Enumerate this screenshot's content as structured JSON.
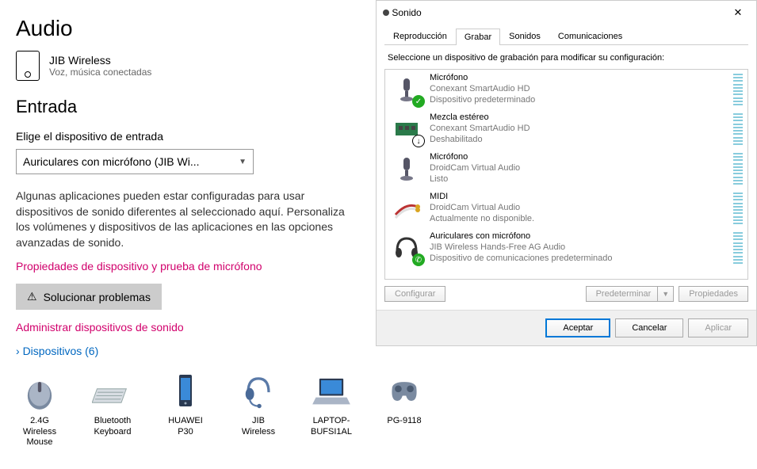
{
  "settings": {
    "title": "Audio",
    "device": {
      "name": "JIB Wireless",
      "status": "Voz, música conectadas"
    },
    "input_section": "Entrada",
    "input_label": "Elige el dispositivo de entrada",
    "input_value": "Auriculares con micrófono (JIB Wi...",
    "note": "Algunas aplicaciones pueden estar configuradas para usar dispositivos de sonido diferentes al seleccionado aquí. Personaliza los volúmenes y dispositivos de las aplicaciones en las opciones avanzadas de sonido.",
    "link_props": "Propiedades de dispositivo y prueba de micrófono",
    "troubleshoot": "Solucionar problemas",
    "link_manage": "Administrar dispositivos de sonido",
    "devices_header": "Dispositivos (6)",
    "devices": [
      {
        "label": "2.4G Wireless Mouse",
        "icon": "mouse"
      },
      {
        "label": "Bluetooth Keyboard",
        "icon": "keyboard"
      },
      {
        "label": "HUAWEI P30",
        "icon": "phone"
      },
      {
        "label": "JIB Wireless",
        "icon": "headset"
      },
      {
        "label": "LAPTOP-BUFSI1AL",
        "icon": "laptop"
      },
      {
        "label": "PG-9118",
        "icon": "gamepad"
      }
    ]
  },
  "dialog": {
    "title": "Sonido",
    "tabs": [
      "Reproducción",
      "Grabar",
      "Sonidos",
      "Comunicaciones"
    ],
    "active_tab": 1,
    "instruction": "Seleccione un dispositivo de grabación para modificar su configuración:",
    "items": [
      {
        "title": "Micrófono",
        "sub1": "Conexant SmartAudio HD",
        "sub2": "Dispositivo predeterminado",
        "icon": "mic",
        "badge": "check"
      },
      {
        "title": "Mezcla estéreo",
        "sub1": "Conexant SmartAudio HD",
        "sub2": "Deshabilitado",
        "icon": "board",
        "badge": "down"
      },
      {
        "title": "Micrófono",
        "sub1": "DroidCam Virtual Audio",
        "sub2": "Listo",
        "icon": "mic",
        "badge": ""
      },
      {
        "title": "MIDI",
        "sub1": "DroidCam Virtual Audio",
        "sub2": "Actualmente no disponible.",
        "icon": "cable",
        "badge": ""
      },
      {
        "title": "Auriculares con micrófono",
        "sub1": "JIB Wireless Hands-Free AG Audio",
        "sub2": "Dispositivo de comunicaciones predeterminado",
        "icon": "headphones",
        "badge": "phone"
      }
    ],
    "btn_config": "Configurar",
    "btn_default": "Predeterminar",
    "btn_props": "Propiedades",
    "btn_ok": "Aceptar",
    "btn_cancel": "Cancelar",
    "btn_apply": "Aplicar"
  }
}
